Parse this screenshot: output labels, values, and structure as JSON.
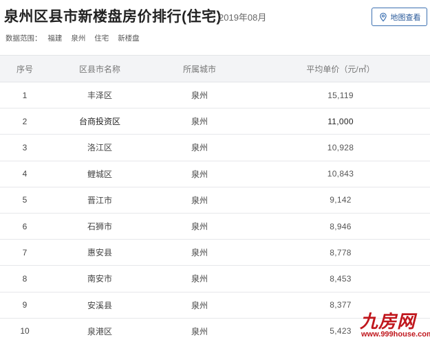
{
  "header": {
    "title": "泉州区县市新楼盘房价排行(住宅)",
    "date": "2019年08月",
    "map_button_label": "地图查看"
  },
  "scope": {
    "label": "数据范围：",
    "items": [
      "福建",
      "泉州",
      "住宅",
      "新楼盘"
    ]
  },
  "table": {
    "columns": [
      "序号",
      "区县市名称",
      "所属城市",
      "平均单价（元/㎡）"
    ],
    "rows": [
      {
        "idx": "1",
        "name": "丰泽区",
        "city": "泉州",
        "price": "15,119"
      },
      {
        "idx": "2",
        "name": "台商投资区",
        "city": "泉州",
        "price": "11,000"
      },
      {
        "idx": "3",
        "name": "洛江区",
        "city": "泉州",
        "price": "10,928"
      },
      {
        "idx": "4",
        "name": "鲤城区",
        "city": "泉州",
        "price": "10,843"
      },
      {
        "idx": "5",
        "name": "晋江市",
        "city": "泉州",
        "price": "9,142"
      },
      {
        "idx": "6",
        "name": "石狮市",
        "city": "泉州",
        "price": "8,946"
      },
      {
        "idx": "7",
        "name": "惠安县",
        "city": "泉州",
        "price": "8,778"
      },
      {
        "idx": "8",
        "name": "南安市",
        "city": "泉州",
        "price": "8,453"
      },
      {
        "idx": "9",
        "name": "安溪县",
        "city": "泉州",
        "price": "8,377"
      },
      {
        "idx": "10",
        "name": "泉港区",
        "city": "泉州",
        "price": "5,423"
      }
    ]
  },
  "watermark": {
    "brand": "九房网",
    "url": "www.999house.com"
  },
  "icons": {
    "map_button": "map-pin-icon"
  },
  "colors": {
    "accent": "#3a6fb0",
    "watermark": "#c0171d",
    "header_bg": "#f3f4f6"
  }
}
